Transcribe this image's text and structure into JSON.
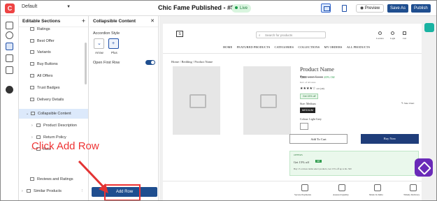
{
  "topbar": {
    "theme": "Default",
    "title": "Chic Fame Published - #89513",
    "status": "Live",
    "preview_label": "Preview",
    "save_label": "Save As",
    "publish_label": "Publish"
  },
  "sections": {
    "header": "Editable Sections",
    "items": [
      {
        "label": "Ratings"
      },
      {
        "label": "Best Offer"
      },
      {
        "label": "Variants"
      },
      {
        "label": "Buy Buttons"
      },
      {
        "label": "All Offers"
      },
      {
        "label": "Trust Badges"
      },
      {
        "label": "Delivery Details"
      },
      {
        "label": "Collapsible Content"
      },
      {
        "label": "Product Description"
      },
      {
        "label": "Return Policy"
      },
      {
        "label": "Row"
      },
      {
        "label": "Reviews and Ratings"
      },
      {
        "label": "Similar Products"
      }
    ]
  },
  "panel": {
    "header": "Collapsible Content",
    "accordion_style_label": "Accordion Style",
    "styles": [
      {
        "label": "Arrow",
        "glyph": "⌄"
      },
      {
        "label": "Plus",
        "glyph": "+"
      }
    ],
    "open_first_row_label": "Open First Row",
    "open_first_row_on": true,
    "add_row_label": "Add Row"
  },
  "annotation": {
    "callout": "Click Add Row",
    "color": "#e33333"
  },
  "store": {
    "search_placeholder": "Search for products",
    "nav": [
      "HOME",
      "FEATURED PRODUCTS",
      "CATEGORIES",
      "COLLECTIONS",
      "MY ORDERS",
      "ALL PRODUCTS"
    ],
    "header_icons": [
      {
        "name": "location-icon",
        "label": "Location"
      },
      {
        "name": "user-icon",
        "label": "Login"
      },
      {
        "name": "cart-icon",
        "label": "Cart"
      }
    ],
    "breadcrumb": "Home / Bedding / Product Name",
    "product_name": "Product Name",
    "price": "₹800",
    "mrp": "MRP ₹1000",
    "discount": "20% Off",
    "tax_note": "Incl. of all taxes",
    "rating": "4.6 (40)",
    "offer_tag": "Get 15% off",
    "size_label": "Size: Medium",
    "size_chart": "Size Chart",
    "size_selected": "MEDIUM",
    "colour_label": "Colour: Light Grey",
    "add_to_cart": "Add To Cart",
    "buy_now": "Buy Now",
    "offers_title": "OFFERS",
    "offer_heading": "Get 15% off",
    "offer_code": "NE",
    "offer_desc": "Buy 15 or more items select products, Get 15% off up to Rs. 500",
    "badges": [
      "Secure Payments",
      "Assured Quality",
      "Made In India",
      "Timely Delivery"
    ],
    "logo_text": "S"
  },
  "colors": {
    "primary": "#1f4e8f",
    "selected_row": "#dce9fb",
    "live_bg": "#d9f5df",
    "accent_teal": "#19b3a2",
    "accent_purple": "#6a2ab8"
  }
}
